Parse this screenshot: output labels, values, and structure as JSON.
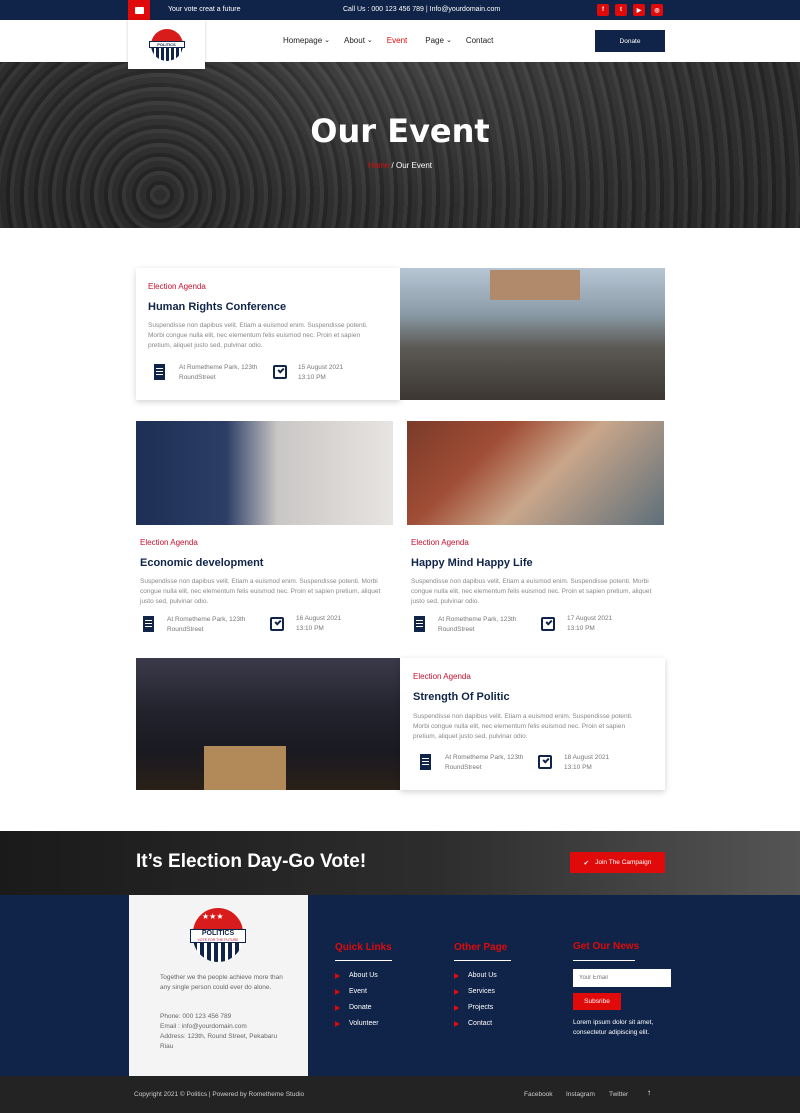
{
  "topbar": {
    "tagline": "Your vote creat a future",
    "contact": "Call Us : 000 123 456 789 | Info@yourdomain.com",
    "socials": [
      "facebook-icon",
      "twitter-icon",
      "youtube-icon",
      "instagram-icon"
    ]
  },
  "nav": {
    "logo_text": "POLITICS",
    "items": [
      "Homepage",
      "About",
      "Event",
      "Page",
      "Contact"
    ],
    "active": "Event",
    "donate": "Donate"
  },
  "hero": {
    "title": "Our Event",
    "crumb_home": "Home",
    "crumb_sep": " / ",
    "crumb_current": "Our Event"
  },
  "events": [
    {
      "category": "Election Agenda",
      "title": "Human Rights Conference",
      "desc": "Suspendisse non dapibus velit. Etiam a euismod enim. Suspendisse potenti. Morbi congue nulla elit, nec elementum felis euismod nec. Proin et sapien pretium, aliquet justo sed, pulvinar odio.",
      "location": "At Rometheme Park, 123th RoundStreet",
      "date": "15 August 2021",
      "time": "13:10 PM"
    },
    {
      "category": "Election Agenda",
      "title": "Economic development",
      "desc": "Suspendisse non dapibus velit. Etiam a euismod enim. Suspendisse potenti. Morbi congue nulla elit, nec elementum felis euismod nec. Proin et sapien pretium, aliquet justo sed, pulvinar odio.",
      "location": "At Rometheme Park, 123th RoundStreet",
      "date": "16 August 2021",
      "time": "13:10 PM"
    },
    {
      "category": "Election Agenda",
      "title": "Happy Mind Happy Life",
      "desc": "Suspendisse non dapibus velit. Etiam a euismod enim. Suspendisse potenti. Morbi congue nulla elit, nec elementum felis euismod nec. Proin et sapien pretium, aliquet justo sed, pulvinar odio.",
      "location": "At Rometheme Park, 123th RoundStreet",
      "date": "17 August 2021",
      "time": "13:10 PM"
    },
    {
      "category": "Election Agenda",
      "title": "Strength Of Politic",
      "desc": "Suspendisse non dapibus velit. Etiam a euismod enim. Suspendisse potenti. Morbi congue nulla elit, nec elementum felis euismod nec. Proin et sapien pretium, aliquet justo sed, pulvinar odio.",
      "location": "At Rometheme Park, 123th RoundStreet",
      "date": "18 August 2021",
      "time": "13:10 PM"
    }
  ],
  "cta": {
    "heading": "It’s Election Day-Go Vote!",
    "button": "Join The Campaign"
  },
  "footer": {
    "about": "Together we the people achieve more than any single person could ever do alone.",
    "phone": "Phone: 000 123 456 789",
    "email": "Email : info@yourdomain.com",
    "address": "Address: 123th, Round Street, Pekabaru Riau",
    "logo_tagline": "VOTE FOR THE FUTURE",
    "quick_links_title": "Quick Links",
    "quick_links": [
      "About Us",
      "Event",
      "Donate",
      "Volunteer"
    ],
    "other_title": "Other Page",
    "other_links": [
      "About Us",
      "Services",
      "Projects",
      "Contact"
    ],
    "news_title": "Get Our News",
    "email_placeholder": "Your Email",
    "subscribe": "Subsribe",
    "news_text": "Lorem ipsum dolor sit amet, consectetur adipiscing elit."
  },
  "bottom": {
    "copyright": "Copyright 2021 © Politics | Powered by Rometheme Studio",
    "links": [
      "Facebook",
      "Instagram",
      "Twitter"
    ],
    "up": "↑"
  },
  "colors": {
    "navy": "#0f2448",
    "red": "#e00a0a"
  }
}
